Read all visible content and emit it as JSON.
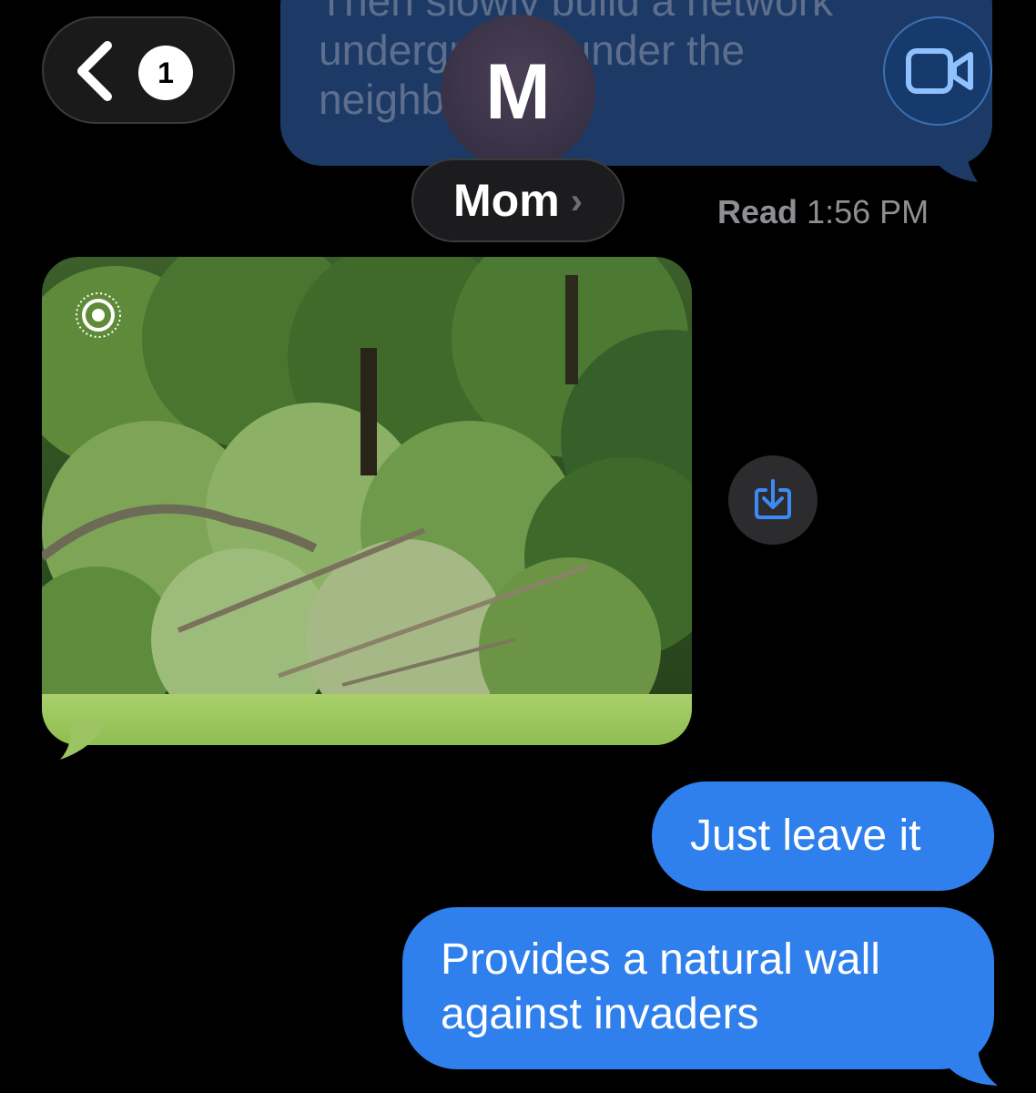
{
  "previous_message": {
    "text": "Then slowly build a network underground under the neighborhood"
  },
  "header": {
    "back_badge_count": "1",
    "avatar_initial": "M",
    "contact_name": "Mom",
    "chevron": "›"
  },
  "read_receipt": {
    "label": "Read",
    "time": "1:56 PM"
  },
  "incoming": {
    "photo_alt": "Photo of fallen tree branches in front of a wooded area",
    "live_photo_icon": "live-photo-icon",
    "save_icon": "download-icon"
  },
  "outgoing": [
    {
      "text": "Just leave it"
    },
    {
      "text": "Provides a natural wall against invaders"
    }
  ],
  "colors": {
    "background": "#000000",
    "outgoing_bubble": "#2f80ed",
    "prev_bubble": "#1d3a66",
    "pill_bg": "#1c1c1e",
    "receipt_text": "#8e8e93"
  }
}
